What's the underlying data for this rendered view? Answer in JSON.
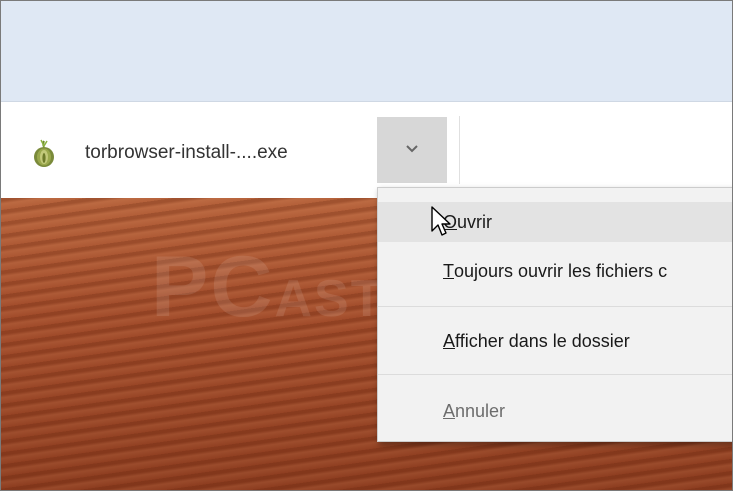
{
  "download": {
    "file_name": "torbrowser-install-....exe",
    "file_icon": "tor-onion-icon",
    "dropdown_icon": "chevron-down-icon"
  },
  "context_menu": {
    "items": [
      {
        "accel": "O",
        "rest": "uvrir",
        "state": "highlighted"
      },
      {
        "accel": "T",
        "rest": "oujours ouvrir les fichiers c",
        "state": "normal"
      },
      {
        "accel": "A",
        "rest": "fficher dans le dossier",
        "state": "normal"
      },
      {
        "accel": "A",
        "rest": "nnuler",
        "state": "disabled"
      }
    ]
  },
  "desktop": {
    "watermark_main": "PC",
    "watermark_tail": "ASTUCES"
  },
  "colors": {
    "top_band": "#dfe8f4",
    "menu_bg": "#f2f2f2",
    "menu_highlight": "#e3e3e3",
    "dropdown_button": "#d7d7d7",
    "desktop": "#a14b2a"
  }
}
